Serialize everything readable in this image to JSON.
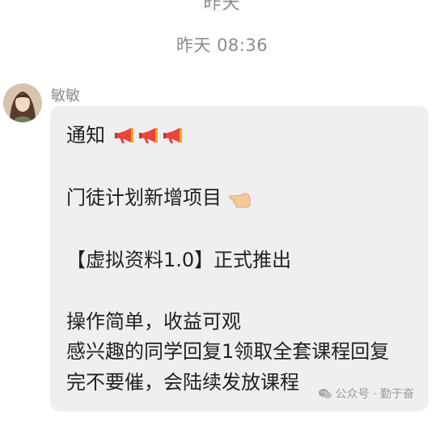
{
  "chat": {
    "top_cut_label": "昨天",
    "timestamp": "昨天 08:36"
  },
  "sender": {
    "name": "敏敏"
  },
  "message": {
    "lines": [
      "通知",
      "门徒计划新增项目",
      "【虚拟资料1.0】正式推出",
      "操作简单，收益可观",
      "感兴趣的同学回复1领取全套课程回复",
      "完不要催，会陆续发放课程"
    ],
    "emoji": {
      "megaphone": "megaphone-icon",
      "pointing": "backhand-index-pointing-left-icon"
    }
  },
  "watermark": {
    "label": "公众号 · 勤于奋",
    "icon": "wechat-icon"
  }
}
